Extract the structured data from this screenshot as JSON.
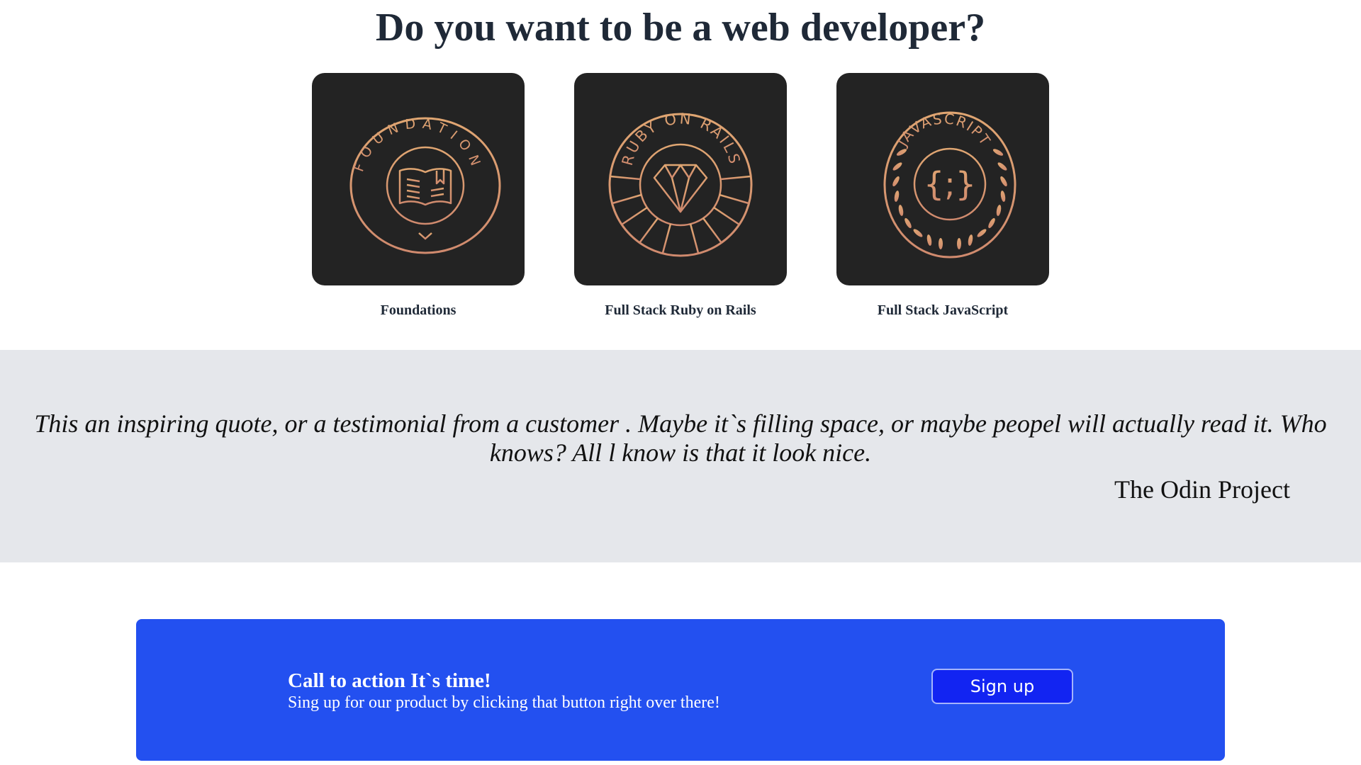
{
  "hero": {
    "title": "Do you want to be a web developer?"
  },
  "courses": [
    {
      "label": "Foundations",
      "badge_text": "FOUNDATION",
      "icon": "book-icon"
    },
    {
      "label": "Full Stack Ruby on Rails",
      "badge_text": "RUBY ON RAILS",
      "icon": "diamond-icon"
    },
    {
      "label": "Full Stack JavaScript",
      "badge_text": "JAVASCRIPT",
      "icon": "braces-icon"
    }
  ],
  "quote": {
    "text": "This an inspiring quote, or a testimonial from a customer . Maybe it`s filling space, or maybe peopel will actually read it. Who knows? All l know is that it look nice.",
    "author": "The Odin Project"
  },
  "cta": {
    "title": "Call to action It`s time!",
    "subtitle": "Sing up for our product by clicking that button right over there!",
    "button_label": "Sign up"
  },
  "colors": {
    "title": "#1f2937",
    "card_bg": "#232323",
    "badge_gold": "#d99a6c",
    "quote_bg": "#e5e7eb",
    "cta_bg": "#2350f0",
    "button_bg": "#1224f2"
  }
}
